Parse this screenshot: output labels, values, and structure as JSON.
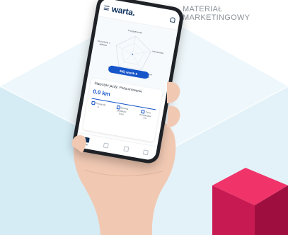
{
  "marketing_label": {
    "line1": "MATERIAŁ",
    "line2": "MARKETINGOWY"
  },
  "app": {
    "brand": "warta.",
    "radar_labels": {
      "top": "Przyspieszanie",
      "left": "Korzystanie z telefonu",
      "right": "Hamowanie",
      "bottom_left": "Przekraczanie prędkości",
      "bottom_right": "Pokonywanie zakrętów"
    },
    "score_button": "Mój wynik 0",
    "stats": {
      "title": "Statystyki jazdy: Podsumowanie",
      "distance": "0.0 km",
      "items": [
        {
          "label": "Przejazdy",
          "value": "0"
        },
        {
          "label": "Średnia prędkość",
          "value": "0 km"
        },
        {
          "label": "Czas przejazdów",
          "value": "0 h"
        }
      ]
    },
    "nav": [
      {
        "label": "Start"
      },
      {
        "label": ""
      },
      {
        "label": ""
      },
      {
        "label": ""
      }
    ]
  },
  "colors": {
    "cube_top": "#eaf5f9",
    "cube_left": "#cfe9f3",
    "cube_right": "#def0f6",
    "accent_blue": "#1554c9",
    "brand_navy": "#0c2f5c",
    "pink_cube_top": "#f0346a",
    "pink_cube_front": "#c81a52",
    "pink_cube_side": "#9e0f3f"
  }
}
